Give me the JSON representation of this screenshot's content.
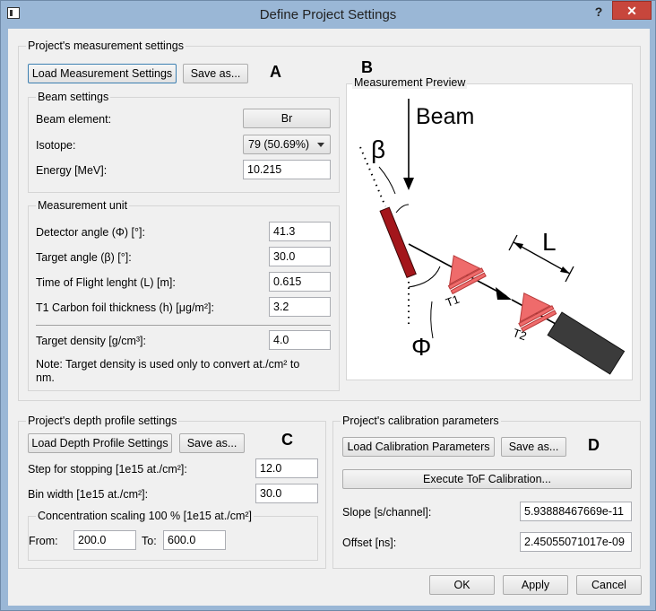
{
  "window": {
    "title": "Define Project Settings",
    "help": "?",
    "close": "✕"
  },
  "measurement": {
    "group_title": "Project's measurement settings",
    "load_btn": "Load Measurement Settings",
    "save_btn": "Save as...",
    "marker_a": "A",
    "marker_b": "B",
    "beam": {
      "group_title": "Beam settings",
      "element_label": "Beam element:",
      "element_value": "Br",
      "isotope_label": "Isotope:",
      "isotope_value": "79 (50.69%)",
      "energy_label": "Energy [MeV]:",
      "energy_value": "10.215"
    },
    "unit": {
      "group_title": "Measurement unit",
      "detector_angle_label": "Detector angle (Φ) [°]:",
      "detector_angle_value": "41.3",
      "target_angle_label": "Target angle (β) [°]:",
      "target_angle_value": "30.0",
      "tof_length_label": "Time of Flight lenght (L) [m]:",
      "tof_length_value": "0.615",
      "foil_label": "T1 Carbon foil thickness (h) [μg/m²]:",
      "foil_value": "3.2",
      "density_label": "Target density [g/cm³]:",
      "density_value": "4.0",
      "note_line1": "Note: Target density is used only to convert at./cm² to",
      "note_line2": "nm."
    },
    "preview": {
      "group_title": "Measurement Preview",
      "beam": "Beam",
      "beta": "β",
      "phi": "Φ",
      "L": "L",
      "T1": "T1",
      "T2": "T2"
    }
  },
  "depth": {
    "group_title": "Project's depth profile settings",
    "load_btn": "Load Depth Profile Settings",
    "save_btn": "Save as...",
    "marker_c": "C",
    "step_label": "Step for stopping [1e15 at./cm²]:",
    "step_value": "12.0",
    "bin_label": "Bin width [1e15 at./cm²]:",
    "bin_value": "30.0",
    "conc_title": "Concentration scaling 100 % [1e15 at./cm²]",
    "from_label": "From:",
    "from_value": "200.0",
    "to_label": "To:",
    "to_value": "600.0"
  },
  "calibration": {
    "group_title": "Project's calibration parameters",
    "load_btn": "Load Calibration Parameters",
    "save_btn": "Save as...",
    "marker_d": "D",
    "execute_btn": "Execute ToF Calibration...",
    "slope_label": "Slope [s/channel]:",
    "slope_value": "5.93888467669e-11",
    "offset_label": "Offset [ns]:",
    "offset_value": "2.45055071017e-09"
  },
  "footer": {
    "ok": "OK",
    "apply": "Apply",
    "cancel": "Cancel"
  }
}
